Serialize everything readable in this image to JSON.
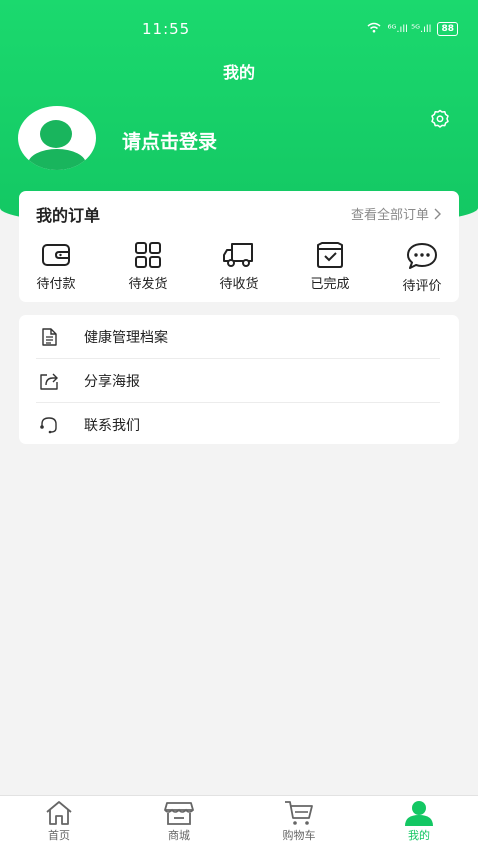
{
  "status_bar": {
    "time": "11:55",
    "network": "⁶ᴳ.ıll ⁵ᴳ.ıll",
    "battery": "88"
  },
  "header": {
    "title": "我的"
  },
  "profile": {
    "login_prompt": "请点击登录"
  },
  "orders": {
    "title": "我的订单",
    "view_all": "查看全部订单",
    "items": [
      {
        "label": "待付款",
        "icon": "wallet-icon"
      },
      {
        "label": "待发货",
        "icon": "grid-icon"
      },
      {
        "label": "待收货",
        "icon": "truck-icon"
      },
      {
        "label": "已完成",
        "icon": "box-check-icon"
      },
      {
        "label": "待评价",
        "icon": "chat-bubble-icon"
      }
    ]
  },
  "menu": {
    "items": [
      {
        "label": "健康管理档案",
        "icon": "document-icon"
      },
      {
        "label": "分享海报",
        "icon": "share-icon"
      },
      {
        "label": "联系我们",
        "icon": "headset-icon"
      }
    ]
  },
  "tabbar": {
    "items": [
      {
        "label": "首页",
        "icon": "home-icon"
      },
      {
        "label": "商城",
        "icon": "store-icon"
      },
      {
        "label": "购物车",
        "icon": "cart-icon"
      },
      {
        "label": "我的",
        "icon": "user-icon"
      }
    ],
    "active_index": 3,
    "active_color": "#13c763"
  },
  "colors": {
    "brand": "#13c763",
    "background": "#f3f3f3"
  }
}
